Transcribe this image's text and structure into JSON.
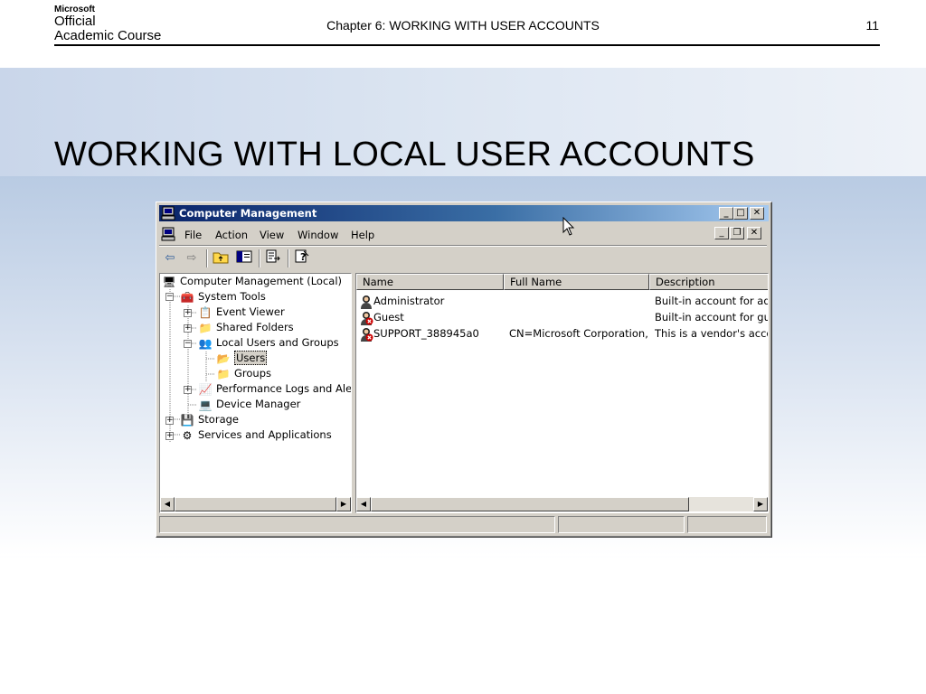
{
  "slide": {
    "logo": {
      "microsoft": "Microsoft",
      "line1": "Official",
      "line2": "Academic Course"
    },
    "chapter": "Chapter 6: WORKING WITH USER ACCOUNTS",
    "page_number": "11",
    "title": "WORKING WITH LOCAL USER ACCOUNTS"
  },
  "window": {
    "title": "Computer Management",
    "caption_buttons": [
      "_",
      "□",
      "✕"
    ],
    "menu": [
      {
        "label": "File"
      },
      {
        "label": "Action"
      },
      {
        "label": "View"
      },
      {
        "label": "Window"
      },
      {
        "label": "Help"
      }
    ],
    "toolbar_icons": [
      "back-arrow-icon",
      "forward-arrow-icon",
      "up-folder-icon",
      "show-hide-tree-icon",
      "export-list-icon",
      "help-icon"
    ],
    "tree": [
      {
        "label": "Computer Management (Local)",
        "icon": "computer-icon"
      },
      {
        "label": "System Tools",
        "icon": "tools-icon"
      },
      {
        "label": "Event Viewer",
        "icon": "event-viewer-icon"
      },
      {
        "label": "Shared Folders",
        "icon": "folder-icon"
      },
      {
        "label": "Local Users and Groups",
        "icon": "users-icon"
      },
      {
        "label": "Users",
        "icon": "folder-open-icon",
        "selected": true
      },
      {
        "label": "Groups",
        "icon": "folder-icon"
      },
      {
        "label": "Performance Logs and Alerts",
        "icon": "performance-icon"
      },
      {
        "label": "Device Manager",
        "icon": "device-manager-icon"
      },
      {
        "label": "Storage",
        "icon": "storage-icon"
      },
      {
        "label": "Services and Applications",
        "icon": "services-icon"
      }
    ],
    "columns": [
      "Name",
      "Full Name",
      "Description"
    ],
    "rows": [
      {
        "name": "Administrator",
        "full_name": "",
        "description": "Built-in account for admi",
        "disabled": false
      },
      {
        "name": "Guest",
        "full_name": "",
        "description": "Built-in account for gues",
        "disabled": true
      },
      {
        "name": "SUPPORT_388945a0",
        "full_name": "CN=Microsoft Corporation,...",
        "description": "This is a vendor's accou",
        "disabled": true
      }
    ]
  },
  "colors": {
    "title_bar_start": "#0a246a",
    "title_bar_end": "#a6caf0",
    "window_face": "#d4d0c8",
    "disabled_badge": "#cc0000"
  }
}
